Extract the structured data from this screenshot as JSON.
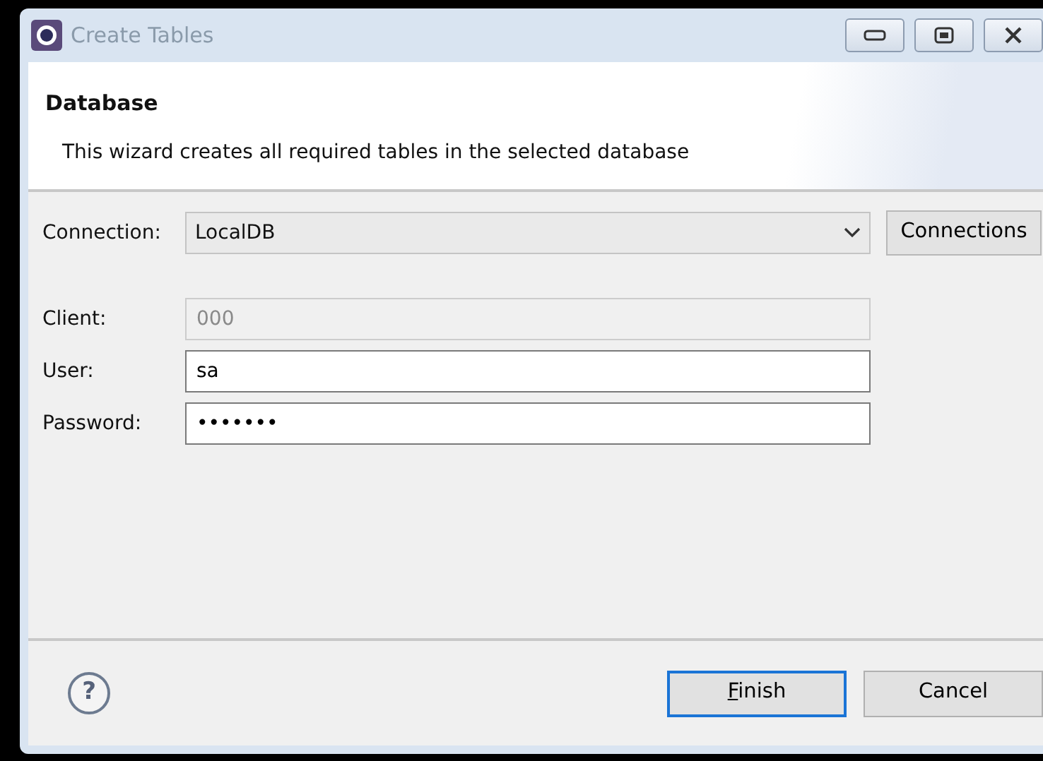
{
  "window": {
    "title": "Create Tables"
  },
  "header": {
    "title": "Database",
    "description": "This wizard creates all required tables in the selected database"
  },
  "connection": {
    "label": "Connection:",
    "value": "LocalDB",
    "button": "Connections"
  },
  "fields": [
    {
      "label": "Client:",
      "value": "000",
      "disabled": true
    },
    {
      "label": "User:",
      "value": "sa",
      "disabled": false
    },
    {
      "label": "Password:",
      "value": "•••••••",
      "disabled": false
    }
  ],
  "footer": {
    "help": "?",
    "buttons": [
      {
        "label": "Finish",
        "default": true,
        "mnemonic_underlined": true
      },
      {
        "label": "Cancel",
        "default": false,
        "mnemonic_underlined": false
      }
    ]
  }
}
